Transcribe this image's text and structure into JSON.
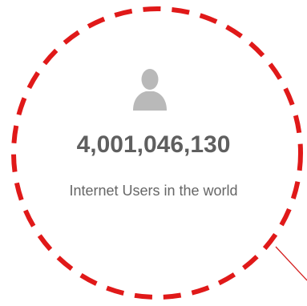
{
  "stat": {
    "icon": "user-icon",
    "value": "4,001,046,130",
    "label": "Internet Users in the world"
  },
  "annotation": {
    "circle_color": "#e01919",
    "pointer_color": "#d42020"
  },
  "colors": {
    "number": "#5f5f5f",
    "label": "#666666",
    "icon": "#b9b9b9"
  }
}
